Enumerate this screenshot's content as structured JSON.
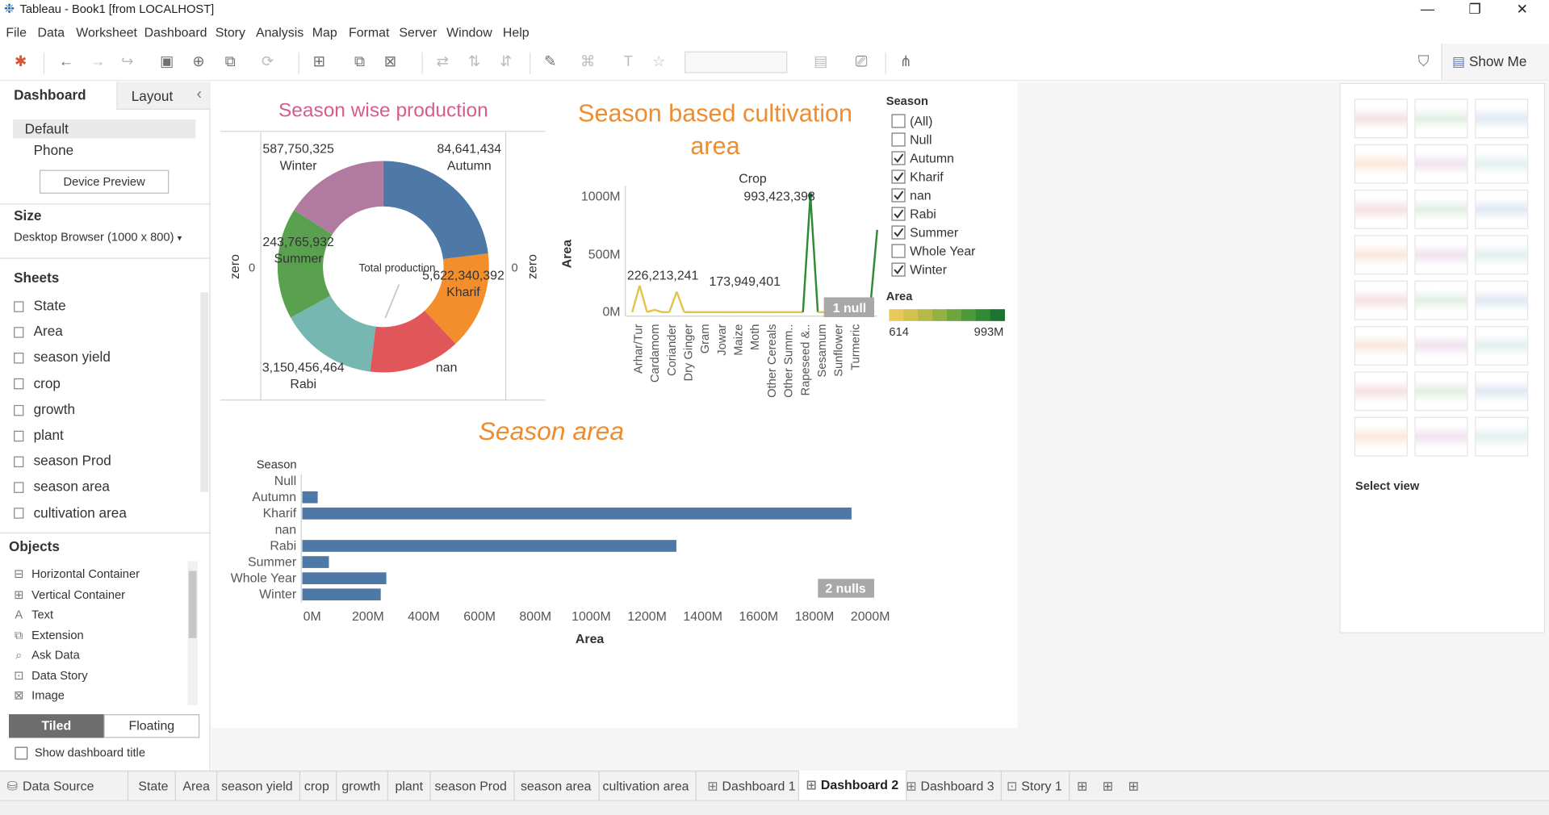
{
  "window": {
    "title": "Tableau - Book1 [from LOCALHOST]",
    "minimize": "—",
    "restore": "❐",
    "close": "✕"
  },
  "menu": [
    "File",
    "Data",
    "Worksheet",
    "Dashboard",
    "Story",
    "Analysis",
    "Map",
    "Format",
    "Server",
    "Window",
    "Help"
  ],
  "toolbar": {
    "show_me": "Show Me"
  },
  "left": {
    "tab_dashboard": "Dashboard",
    "tab_layout": "Layout",
    "collapse": "‹",
    "devices": [
      "Default",
      "Phone"
    ],
    "device_preview": "Device Preview",
    "size_title": "Size",
    "size_value": "Desktop Browser (1000 x 800)",
    "sheets_title": "Sheets",
    "sheets": [
      "State",
      "Area",
      "season yield",
      "crop",
      "growth",
      "plant",
      "season Prod",
      "season area",
      "cultivation area"
    ],
    "objects_title": "Objects",
    "objects": [
      {
        "icon": "horizontal-container-icon",
        "label": "Horizontal Container"
      },
      {
        "icon": "vertical-container-icon",
        "label": "Vertical Container"
      },
      {
        "icon": "text-icon",
        "label": "Text"
      },
      {
        "icon": "extension-icon",
        "label": "Extension"
      },
      {
        "icon": "ask-data-icon",
        "label": "Ask Data"
      },
      {
        "icon": "data-story-icon",
        "label": "Data Story"
      },
      {
        "icon": "image-icon",
        "label": "Image"
      }
    ],
    "tiled": "Tiled",
    "floating": "Floating",
    "show_title": "Show dashboard title"
  },
  "dashboard": {
    "donut": {
      "title": "Season wise production",
      "center_label": "Total production",
      "left_axis": "zero",
      "right_axis": "zero",
      "left_zero": "0",
      "right_zero": "0",
      "labels": [
        {
          "value": "587,750,325",
          "season": "Winter"
        },
        {
          "value": "84,641,434",
          "season": "Autumn"
        },
        {
          "value": "243,765,932",
          "season": "Summer"
        },
        {
          "value": "5,622,340,392",
          "season": "Kharif"
        },
        {
          "value": "3,150,456,464",
          "season": "Rabi"
        },
        {
          "value": "",
          "season": "nan"
        }
      ]
    },
    "line": {
      "title_line1": "Season based cultivation",
      "title_line2": "area",
      "header": "Crop",
      "ylabel": "Area",
      "yticks": [
        "1000M",
        "500M",
        "0M"
      ],
      "annotations": [
        "993,423,398",
        "226,213,241",
        "173,949,401"
      ],
      "null_badge": "1 null",
      "crops": [
        "Arhar/Tur",
        "Cardamom",
        "Coriander",
        "Dry Ginger",
        "Gram",
        "Jowar",
        "Maize",
        "Moth",
        "Other Cereals",
        "Other Summ..",
        "Rapeseed &..",
        "Sesamum",
        "Sunflower",
        "Turmeric"
      ]
    },
    "bar": {
      "title": "Season area",
      "header": "Season",
      "xlabel": "Area",
      "xticks": [
        "0M",
        "200M",
        "400M",
        "600M",
        "800M",
        "1000M",
        "1200M",
        "1400M",
        "1600M",
        "1800M",
        "2000M"
      ],
      "null_badge": "2 nulls"
    },
    "filter": {
      "title": "Season",
      "items": [
        {
          "label": "(All)",
          "checked": false
        },
        {
          "label": "Null",
          "checked": false
        },
        {
          "label": "Autumn",
          "checked": true
        },
        {
          "label": "Kharif",
          "checked": true
        },
        {
          "label": "nan",
          "checked": true
        },
        {
          "label": "Rabi",
          "checked": true
        },
        {
          "label": "Summer",
          "checked": true
        },
        {
          "label": "Whole Year",
          "checked": false
        },
        {
          "label": "Winter",
          "checked": true
        }
      ]
    },
    "legend": {
      "title": "Area",
      "min": "614",
      "max": "993M",
      "colors": [
        "#e8c95a",
        "#d2c04f",
        "#b5b94a",
        "#93b144",
        "#6fa53f",
        "#4c9a3a",
        "#2f8a35",
        "#1b7430"
      ]
    }
  },
  "chart_data": [
    {
      "type": "pie",
      "title": "Season wise production",
      "categories": [
        "Autumn",
        "Kharif",
        "nan",
        "Rabi",
        "Summer",
        "Winter"
      ],
      "values": [
        84641434,
        5622340392,
        0,
        3150456464,
        243765932,
        587750325
      ],
      "colors": [
        "#4e79a7",
        "#f28e2b",
        "#e15759",
        "#76b7b2",
        "#59a14f",
        "#b07aa1"
      ]
    },
    {
      "type": "line",
      "title": "Season based cultivation area",
      "xlabel": "Crop",
      "ylabel": "Area",
      "ylim": [
        0,
        1000000000
      ],
      "y": [
        0,
        226213241,
        0,
        20000000,
        0,
        0,
        173949401,
        0,
        0,
        0,
        0,
        0,
        0,
        0,
        0,
        0,
        0,
        0,
        0,
        0,
        0,
        0,
        0,
        0,
        993423398,
        0,
        0,
        0,
        0,
        0,
        0,
        0,
        0,
        700000000
      ]
    },
    {
      "type": "bar",
      "title": "Season area",
      "categories": [
        "Null",
        "Autumn",
        "Kharif",
        "nan",
        "Rabi",
        "Summer",
        "Whole Year",
        "Winter"
      ],
      "values": [
        0,
        55000000,
        1960000000,
        0,
        1335000000,
        95000000,
        300000000,
        280000000
      ],
      "xlabel": "Area",
      "xlim": [
        0,
        2000000000
      ],
      "color": "#4e79a7"
    }
  ],
  "bottom": {
    "data_source": "Data Source",
    "tabs": [
      "State",
      "Area",
      "season yield",
      "crop",
      "growth",
      "plant",
      "season Prod",
      "season area",
      "cultivation area"
    ],
    "dashboards": [
      "Dashboard 1",
      "Dashboard 2",
      "Dashboard 3"
    ],
    "story": "Story 1",
    "active": "Dashboard 2"
  },
  "showme": {
    "select_view": "Select view"
  }
}
